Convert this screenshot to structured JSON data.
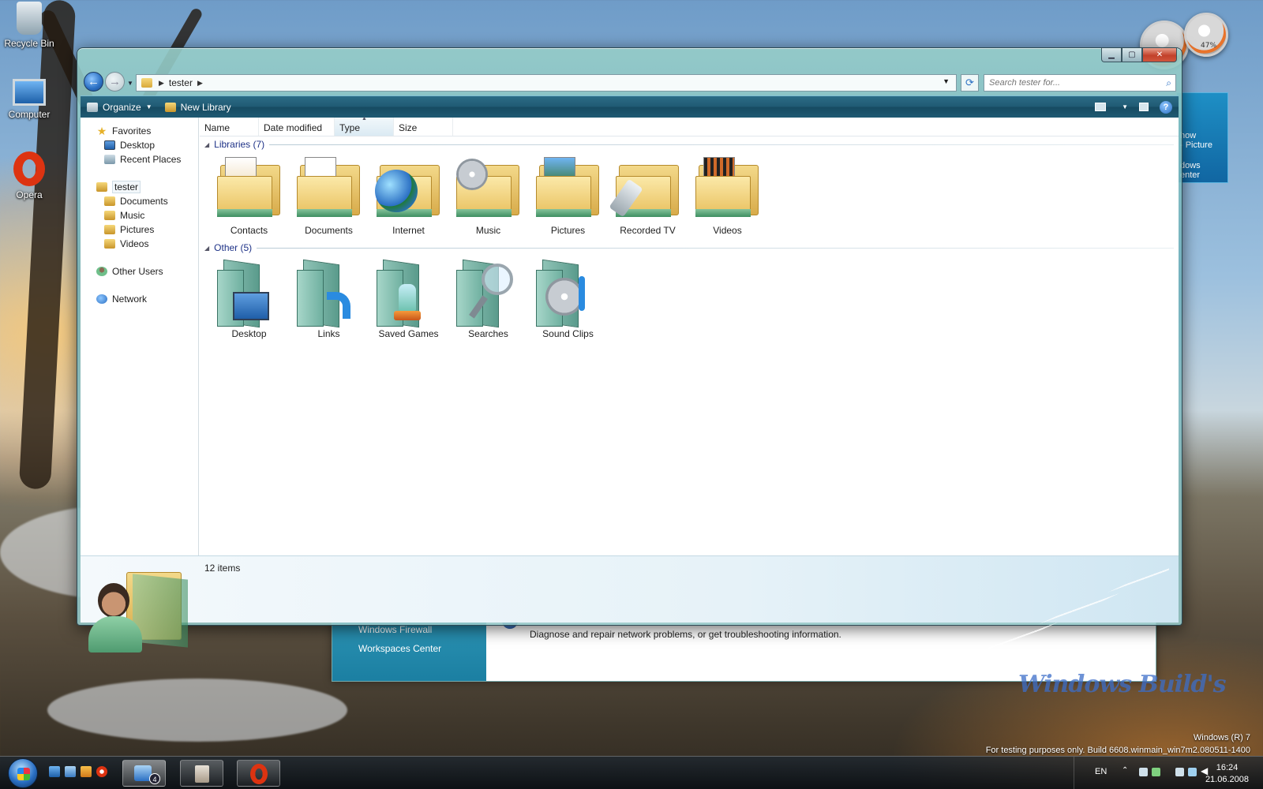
{
  "desktop": {
    "icons": [
      {
        "label": "Recycle Bin",
        "icon": "recycle-bin-icon"
      },
      {
        "label": "Computer",
        "icon": "computer-icon"
      },
      {
        "label": "Opera",
        "icon": "opera-icon"
      }
    ],
    "gadget_cpu": "47%",
    "side_gadget_lines": [
      "how",
      "- Picture",
      "dows",
      "enter"
    ]
  },
  "bg_window": {
    "links": [
      "Windows Firewall",
      "Workspaces Center"
    ],
    "description": "Diagnose and repair network problems, or get troubleshooting information."
  },
  "window": {
    "controls": {
      "minimize": "▁",
      "maximize": "▢",
      "close": "✕"
    },
    "address": {
      "crumbs": [
        "tester"
      ]
    },
    "search": {
      "placeholder": "Search tester for..."
    },
    "toolbar": {
      "organize": "Organize",
      "new_library": "New Library"
    },
    "nav_pane": {
      "favorites": {
        "label": "Favorites",
        "items": [
          "Desktop",
          "Recent Places"
        ]
      },
      "user": {
        "label": "tester",
        "items": [
          "Documents",
          "Music",
          "Pictures",
          "Videos"
        ]
      },
      "other_users": "Other Users",
      "network": "Network"
    },
    "columns": [
      "Name",
      "Date modified",
      "Type",
      "Size"
    ],
    "groups": [
      {
        "title": "Libraries (7)",
        "items": [
          "Contacts",
          "Documents",
          "Internet",
          "Music",
          "Pictures",
          "Recorded TV",
          "Videos"
        ]
      },
      {
        "title": "Other (5)",
        "items": [
          "Desktop",
          "Links",
          "Saved Games",
          "Searches",
          "Sound Clips"
        ]
      }
    ],
    "status": {
      "count": "12 items"
    }
  },
  "watermark": {
    "brand": "Windows Build's",
    "os": "Windows (R) 7",
    "build": "For testing purposes only. Build 6608.winmain_win7m2.080511-1400"
  },
  "taskbar": {
    "badge": "4",
    "lang": "EN",
    "time": "16:24",
    "date": "21.06.2008"
  },
  "colors": {
    "toolbar": "#1f5a73",
    "group_header": "#1e3287",
    "accent_blue": "#2a6fc3"
  }
}
